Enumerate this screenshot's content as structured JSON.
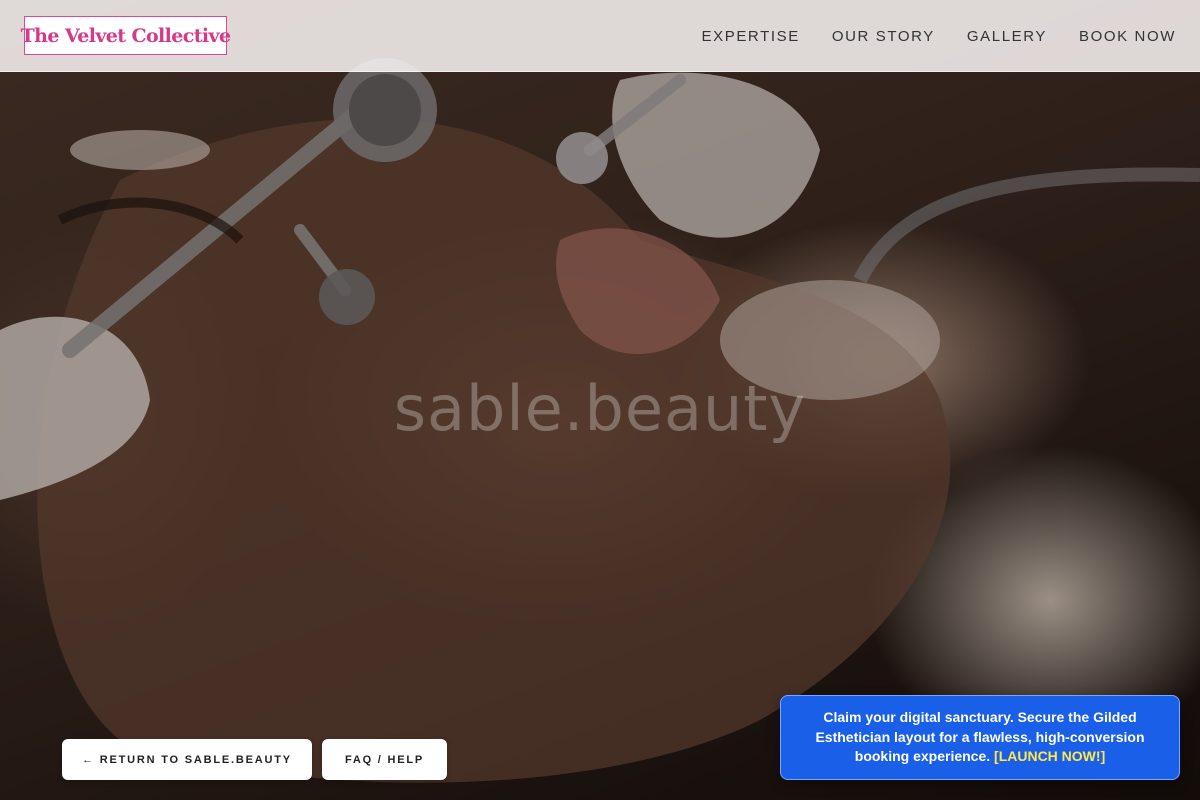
{
  "header": {
    "logo_text": "The Velvet Collective",
    "nav": [
      {
        "label": "EXPERTISE"
      },
      {
        "label": "OUR STORY"
      },
      {
        "label": "GALLERY"
      },
      {
        "label": "BOOK NOW"
      }
    ]
  },
  "hero": {
    "watermark": "sable.beauty"
  },
  "actions": {
    "return_label": "← RETURN TO SABLE.BEAUTY",
    "faq_label": "FAQ / HELP"
  },
  "promo": {
    "text": "Claim your digital sanctuary. Secure the Gilded Esthetician layout for a flawless, high-conversion booking experience. ",
    "cta": "[LAUNCH NOW!]"
  },
  "colors": {
    "logo_accent": "#d6398c",
    "promo_bg": "#1a5fe8",
    "promo_cta": "#ffe94a"
  }
}
